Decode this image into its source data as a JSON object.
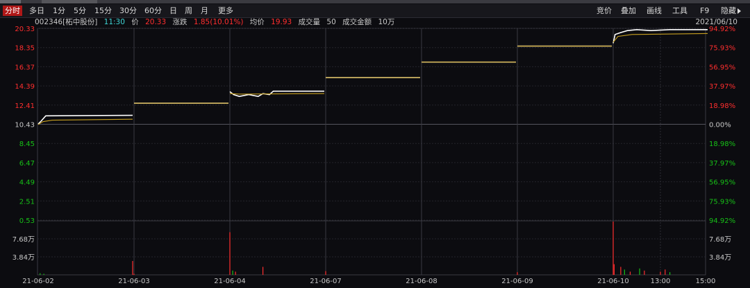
{
  "toolbar": {
    "periods": [
      "分时",
      "多日",
      "1分",
      "5分",
      "15分",
      "30分",
      "60分",
      "日",
      "周",
      "月",
      "更多"
    ],
    "right": [
      "竞价",
      "叠加",
      "画线",
      "工具",
      "F9",
      "隐藏"
    ]
  },
  "info": {
    "code": "002346",
    "name": "[柘中股份]",
    "time": "11:30",
    "price_label": "价",
    "price": "20.33",
    "change_label": "涨跌",
    "change": "1.85(10.01%)",
    "avg_label": "均价",
    "avg": "19.93",
    "volume_label": "成交量",
    "volume": "50",
    "amount_label": "成交金额",
    "amount": "10万",
    "date": "2021/06/10"
  },
  "colors": {
    "up": "#ff2e2e",
    "down": "#17c117",
    "price_line": "#ffffff",
    "avg_line": "#c8a020",
    "cyan": "#3fd6d6"
  },
  "chart_data": {
    "type": "line",
    "days": [
      "21-06-02",
      "21-06-03",
      "21-06-04",
      "21-06-07",
      "21-06-08",
      "21-06-09",
      "21-06-10"
    ],
    "x_end_labels": [
      "13:00",
      "15:00"
    ],
    "price_ticks": [
      "20.33",
      "18.35",
      "16.37",
      "14.39",
      "12.41",
      "10.43",
      "8.45",
      "6.47",
      "4.49",
      "2.51",
      "0.53"
    ],
    "pct_ticks": [
      "94.92%",
      "75.93%",
      "56.95%",
      "37.97%",
      "18.98%",
      "0.00%",
      "18.98%",
      "37.97%",
      "56.95%",
      "75.93%",
      "94.92%"
    ],
    "ylim": [
      0.53,
      20.33
    ],
    "base_price": 10.43,
    "volume_ticks": [
      "7.68万",
      "3.84万"
    ],
    "volume_ylim": [
      0,
      10
    ],
    "series": [
      {
        "name": "价",
        "segments": [
          [
            [
              0,
              10.45
            ],
            [
              0.03,
              10.75
            ],
            [
              0.08,
              11.3
            ],
            [
              1,
              11.35
            ]
          ],
          [
            [
              0,
              12.6
            ],
            [
              1,
              12.6
            ]
          ],
          [
            [
              0,
              13.8
            ],
            [
              0.04,
              13.5
            ],
            [
              0.1,
              13.3
            ],
            [
              0.2,
              13.5
            ],
            [
              0.3,
              13.3
            ],
            [
              0.35,
              13.6
            ],
            [
              0.42,
              13.5
            ],
            [
              0.46,
              13.85
            ],
            [
              1,
              13.85
            ]
          ],
          [
            [
              0,
              15.25
            ],
            [
              1,
              15.25
            ]
          ],
          [
            [
              0,
              16.85
            ],
            [
              1,
              16.85
            ]
          ],
          [
            [
              0,
              18.5
            ],
            [
              1,
              18.5
            ]
          ],
          [
            [
              0,
              18.8
            ],
            [
              0.02,
              19.7
            ],
            [
              0.08,
              19.9
            ],
            [
              0.15,
              20.1
            ],
            [
              0.25,
              20.2
            ],
            [
              0.4,
              20.1
            ],
            [
              0.6,
              20.2
            ],
            [
              1,
              20.2
            ]
          ]
        ]
      },
      {
        "name": "均价",
        "segments": [
          [
            [
              0,
              10.4
            ],
            [
              0.05,
              10.7
            ],
            [
              0.15,
              10.85
            ],
            [
              1,
              10.95
            ]
          ],
          [
            [
              0,
              12.6
            ],
            [
              1,
              12.6
            ]
          ],
          [
            [
              0,
              13.6
            ],
            [
              0.1,
              13.55
            ],
            [
              1,
              13.6
            ]
          ],
          [
            [
              0,
              15.25
            ],
            [
              1,
              15.25
            ]
          ],
          [
            [
              0,
              16.85
            ],
            [
              1,
              16.85
            ]
          ],
          [
            [
              0,
              18.5
            ],
            [
              1,
              18.5
            ]
          ],
          [
            [
              0,
              18.9
            ],
            [
              0.05,
              19.5
            ],
            [
              0.2,
              19.7
            ],
            [
              1,
              19.8
            ]
          ]
        ]
      }
    ],
    "volumes": [
      [
        [
          0.02,
          0.3,
          "down"
        ],
        [
          0.06,
          0.2,
          "down"
        ],
        [
          1.0,
          2.6,
          "up"
        ]
      ],
      [
        [
          0,
          0.2,
          "up"
        ]
      ],
      [
        [
          0.0,
          8.0,
          "up"
        ],
        [
          0.03,
          0.8,
          "down"
        ],
        [
          0.06,
          0.6,
          "up"
        ],
        [
          0.35,
          1.5,
          "up"
        ]
      ],
      [
        [
          0.0,
          0.7,
          "up"
        ]
      ],
      [],
      [
        [
          0.0,
          0.5,
          "up"
        ]
      ],
      [
        [
          0.0,
          10.0,
          "up"
        ],
        [
          0.01,
          2.0,
          "up"
        ],
        [
          0.08,
          1.5,
          "up"
        ],
        [
          0.12,
          1.0,
          "down"
        ],
        [
          0.18,
          0.6,
          "up"
        ],
        [
          0.28,
          1.2,
          "down"
        ],
        [
          0.33,
          0.8,
          "up"
        ],
        [
          0.5,
          0.6,
          "up"
        ],
        [
          0.55,
          1.0,
          "up"
        ],
        [
          0.6,
          0.5,
          "down"
        ]
      ]
    ],
    "grid": true
  }
}
